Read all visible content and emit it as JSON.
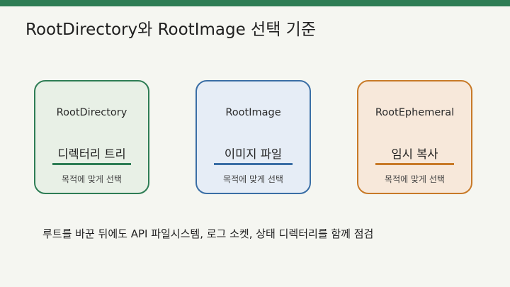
{
  "slide": {
    "title": "RootDirectory와 RootImage 선택 기준",
    "cards": [
      {
        "title": "RootDirectory",
        "subtitle": "디렉터리 트리",
        "caption": "목적에 맞게 선택",
        "border_color": "#2e7d55",
        "background_color": "#e8f0e6",
        "accent_color": "#2e7d55"
      },
      {
        "title": "RootImage",
        "subtitle": "이미지 파일",
        "caption": "목적에 맞게 선택",
        "border_color": "#3a6ea5",
        "background_color": "#e6edf6",
        "accent_color": "#3a6ea5"
      },
      {
        "title": "RootEphemeral",
        "subtitle": "임시 복사",
        "caption": "목적에 맞게 선택",
        "border_color": "#c87a28",
        "background_color": "#f7e8da",
        "accent_color": "#c87a28"
      }
    ],
    "footer": "루트를 바꾼 뒤에도 API 파일시스템, 로그 소켓, 상태 디렉터리를 함께 점검"
  },
  "colors": {
    "top_bar": "#2e7d55",
    "background": "#f5f6f1"
  }
}
